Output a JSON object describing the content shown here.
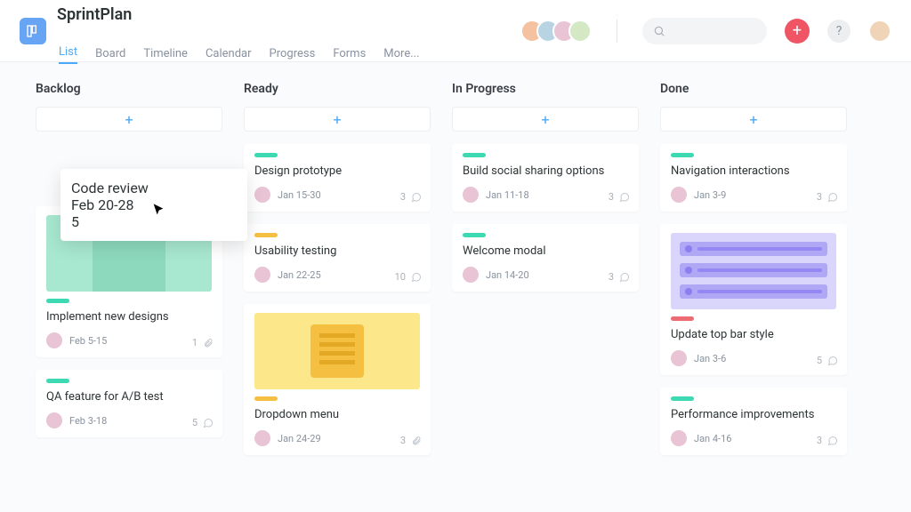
{
  "app": {
    "title": "SprintPlan"
  },
  "nav": {
    "tabs": [
      "List",
      "Board",
      "Timeline",
      "Calendar",
      "Progress",
      "Forms",
      "More..."
    ],
    "active_index": 0
  },
  "toolbar": {
    "add_label": "+",
    "help_label": "?"
  },
  "columns": [
    {
      "title": "Backlog",
      "cards": [
        {
          "pill": "teal",
          "title": "Code review",
          "date": "Feb 20-28",
          "count": 5,
          "icon": "comment",
          "floating": true
        },
        {
          "pill": "teal",
          "title": "Implement new designs",
          "date": "Feb 5-15",
          "count": 1,
          "icon": "attachment",
          "thumb": "mint"
        },
        {
          "pill": "teal",
          "title": "QA feature for A/B test",
          "date": "Feb 3-18",
          "count": 5,
          "icon": "comment"
        }
      ]
    },
    {
      "title": "Ready",
      "cards": [
        {
          "pill": "teal",
          "title": "Design prototype",
          "date": "Jan 15-30",
          "count": 3,
          "icon": "comment"
        },
        {
          "pill": "yellow",
          "title": "Usability testing",
          "date": "Jan 22-25",
          "count": 10,
          "icon": "comment"
        },
        {
          "pill": "yellow",
          "title": "Dropdown menu",
          "date": "Jan 24-29",
          "count": 3,
          "icon": "attachment",
          "thumb": "yellow"
        }
      ]
    },
    {
      "title": "In Progress",
      "cards": [
        {
          "pill": "teal",
          "title": "Build social sharing options",
          "date": "Jan 11-18",
          "count": 3,
          "icon": "comment"
        },
        {
          "pill": "teal",
          "title": "Welcome modal",
          "date": "Jan 14-20",
          "count": 3,
          "icon": "comment"
        }
      ]
    },
    {
      "title": "Done",
      "cards": [
        {
          "pill": "teal",
          "title": "Navigation interactions",
          "date": "Jan 3-9",
          "count": 3,
          "icon": "comment"
        },
        {
          "pill": "red",
          "title": "Update top bar style",
          "date": "Jan 3-6",
          "count": 5,
          "icon": "comment",
          "thumb": "purple"
        },
        {
          "pill": "teal",
          "title": "Performance improvements",
          "date": "Jan 4-16",
          "count": 3,
          "icon": "comment"
        }
      ]
    }
  ]
}
